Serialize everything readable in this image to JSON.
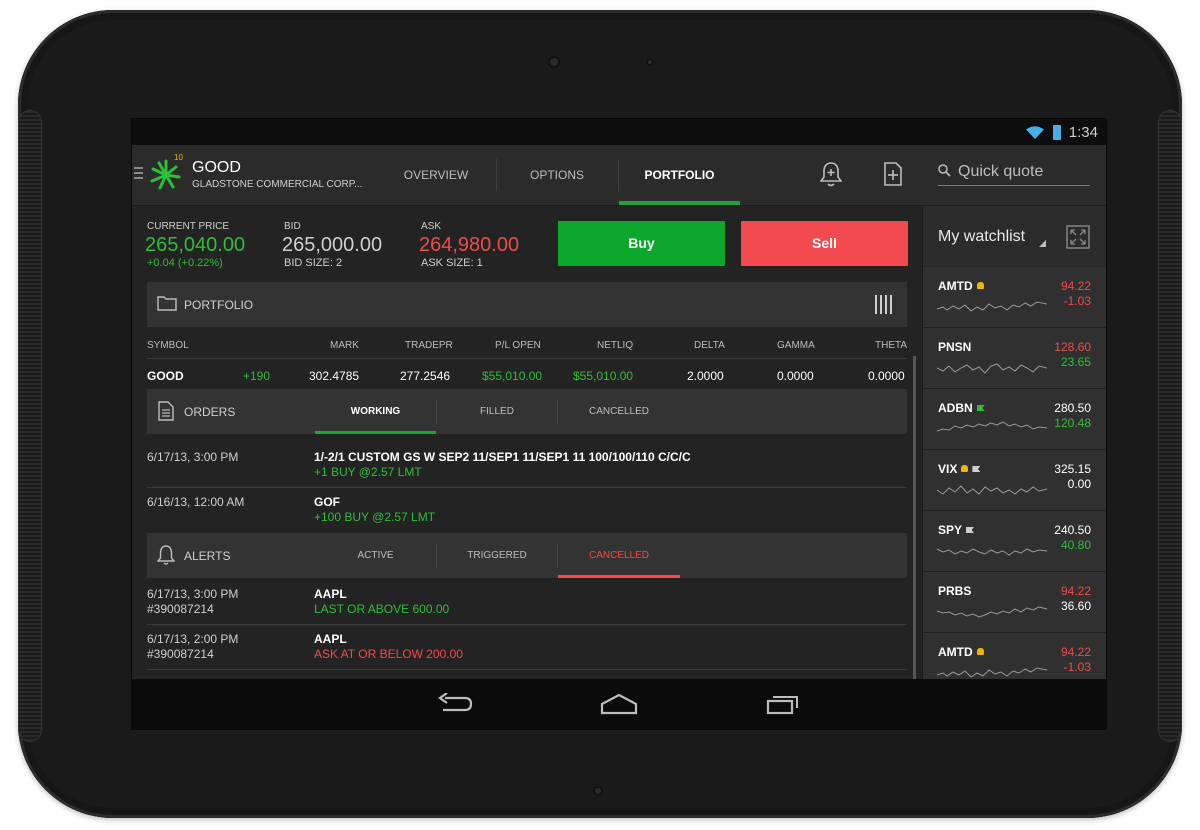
{
  "status": {
    "time": "1:34"
  },
  "header": {
    "symbol": "GOOD",
    "company": "GLADSTONE COMMERCIAL CORP...",
    "logo_badge": "10",
    "tabs": [
      {
        "label": "OVERVIEW"
      },
      {
        "label": "OPTIONS"
      },
      {
        "label": "PORTFOLIO",
        "active": true
      }
    ],
    "quick_quote_placeholder": "Quick quote"
  },
  "quote": {
    "current_price_label": "CURRENT PRICE",
    "current_price": "265,040.00",
    "change": "+0.04 (+0.22%)",
    "bid_label": "BID",
    "bid": "265,000.00",
    "bid_size": "BID SIZE: 2",
    "ask_label": "ASK",
    "ask": "264,980.00",
    "ask_size": "ASK SIZE: 1",
    "buy_label": "Buy",
    "sell_label": "Sell",
    "colors": {
      "buy": "#0ca82e",
      "sell": "#f24a4f",
      "up": "#2dbe3a",
      "down": "#f04a4a"
    }
  },
  "portfolio": {
    "title": "PORTFOLIO",
    "columns": [
      "SYMBOL",
      "MARK",
      "TRADEPR",
      "P/L OPEN",
      "NETLIQ",
      "DELTA",
      "GAMMA",
      "THETA"
    ],
    "row": {
      "symbol": "GOOD",
      "qty": "+190",
      "mark": "302.4785",
      "tradepr": "277.2546",
      "pl_open": "$55,010.00",
      "netliq": "$55,010.00",
      "delta": "2.0000",
      "gamma": "0.0000",
      "theta": "0.0000"
    }
  },
  "orders": {
    "title": "ORDERS",
    "tabs": [
      "WORKING",
      "FILLED",
      "CANCELLED"
    ],
    "items": [
      {
        "date": "6/17/13, 3:00 PM",
        "title": "1/-2/1 CUSTOM GS W SEP2 11/SEP1 11/SEP1 11 100/100/110 C/C/C",
        "detail": "+1 BUY @2.57 LMT"
      },
      {
        "date": "6/16/13, 12:00 AM",
        "title": "GOF",
        "detail": "+100 BUY @2.57 LMT"
      }
    ]
  },
  "alerts": {
    "title": "ALERTS",
    "tabs": [
      "ACTIVE",
      "TRIGGERED",
      "CANCELLED"
    ],
    "items": [
      {
        "date": "6/17/13, 3:00 PM",
        "id": "#390087214",
        "symbol": "AAPL",
        "condition": "LAST OR ABOVE 600.00"
      },
      {
        "date": "6/17/13, 2:00 PM",
        "id": "#390087214",
        "symbol": "AAPL",
        "condition": "ASK AT OR BELOW 200.00"
      }
    ]
  },
  "watchlist": {
    "title": "My watchlist",
    "items": [
      {
        "symbol": "AMTD",
        "p1": "94.22",
        "p2": "-1.03"
      },
      {
        "symbol": "PNSN",
        "p1": "128.60",
        "p2": "23.65"
      },
      {
        "symbol": "ADBN",
        "p1": "280.50",
        "p2": "120.48"
      },
      {
        "symbol": "VIX",
        "p1": "325.15",
        "p2": "0.00"
      },
      {
        "symbol": "SPY",
        "p1": "240.50",
        "p2": "40.80"
      },
      {
        "symbol": "PRBS",
        "p1": "94.22",
        "p2": "36.60"
      },
      {
        "symbol": "AMTD",
        "p1": "94.22",
        "p2": "-1.03"
      }
    ]
  }
}
